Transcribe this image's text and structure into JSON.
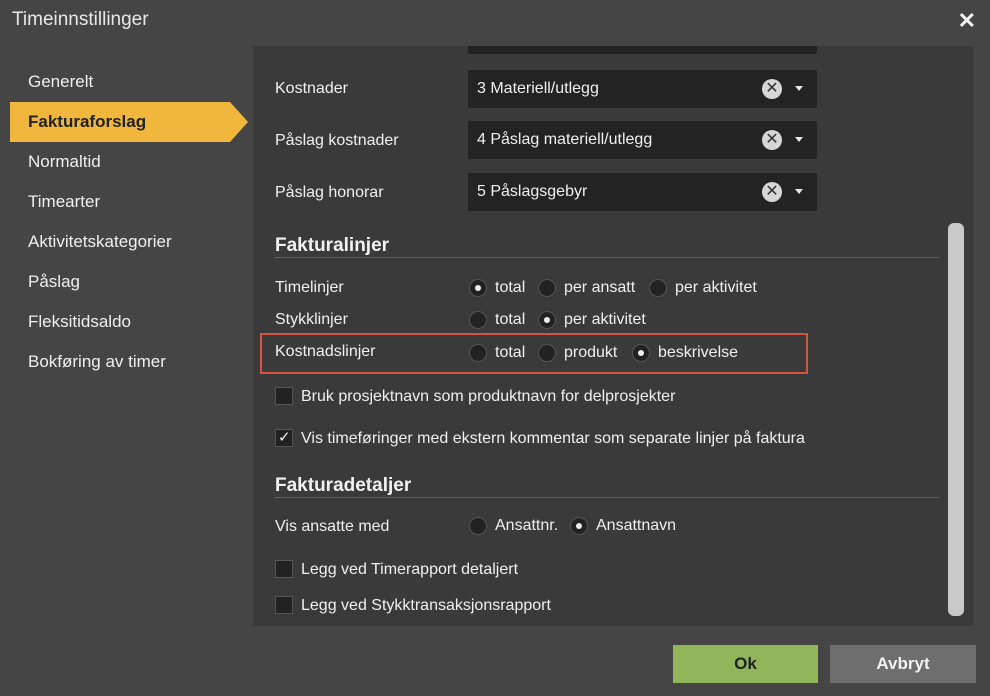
{
  "window": {
    "title": "Timeinnstillinger",
    "close_glyph": "✕"
  },
  "nav": {
    "items": [
      {
        "label": "Generelt"
      },
      {
        "label": "Fakturaforslag",
        "active": true
      },
      {
        "label": "Normaltid"
      },
      {
        "label": "Timearter"
      },
      {
        "label": "Aktivitetskategorier"
      },
      {
        "label": "Påslag"
      },
      {
        "label": "Fleksitidsaldo"
      },
      {
        "label": "Bokføring av timer"
      }
    ]
  },
  "fields": {
    "kostnader": {
      "label": "Kostnader",
      "value": "3 Materiell/utlegg"
    },
    "paslag_kostnader": {
      "label": "Påslag kostnader",
      "value": "4 Påslag materiell/utlegg"
    },
    "paslag_honorar": {
      "label": "Påslag honorar",
      "value": "5 Påslagsgebyr"
    },
    "clear_glyph": "✕"
  },
  "fakturalinjer": {
    "title": "Fakturalinjer",
    "timelinjer": {
      "label": "Timelinjer",
      "options": [
        "total",
        "per ansatt",
        "per aktivitet"
      ],
      "selected": "total"
    },
    "stykklinjer": {
      "label": "Stykklinjer",
      "options": [
        "total",
        "per aktivitet"
      ],
      "selected": "per aktivitet"
    },
    "kostnadslinjer": {
      "label": "Kostnadslinjer",
      "options": [
        "total",
        "produkt",
        "beskrivelse"
      ],
      "selected": "beskrivelse"
    },
    "check_prosjektnavn": {
      "label": "Bruk prosjektnavn som produktnavn for delprosjekter",
      "checked": false
    },
    "check_timeforinger": {
      "label": "Vis timeføringer med ekstern kommentar som separate linjer på faktura",
      "checked": true
    }
  },
  "fakturadetaljer": {
    "title": "Fakturadetaljer",
    "vis_ansatte": {
      "label": "Vis ansatte med",
      "options": [
        "Ansattnr.",
        "Ansattnavn"
      ],
      "selected": "Ansattnavn"
    },
    "check_timerapport": {
      "label": "Legg ved Timerapport detaljert",
      "checked": false
    },
    "check_stykk": {
      "label": "Legg ved Stykktransaksjonsrapport",
      "checked": false
    }
  },
  "buttons": {
    "ok": "Ok",
    "cancel": "Avbryt"
  },
  "colors": {
    "accent": "#f0b73c",
    "ok": "#90b659",
    "highlight": "#d9513f"
  }
}
